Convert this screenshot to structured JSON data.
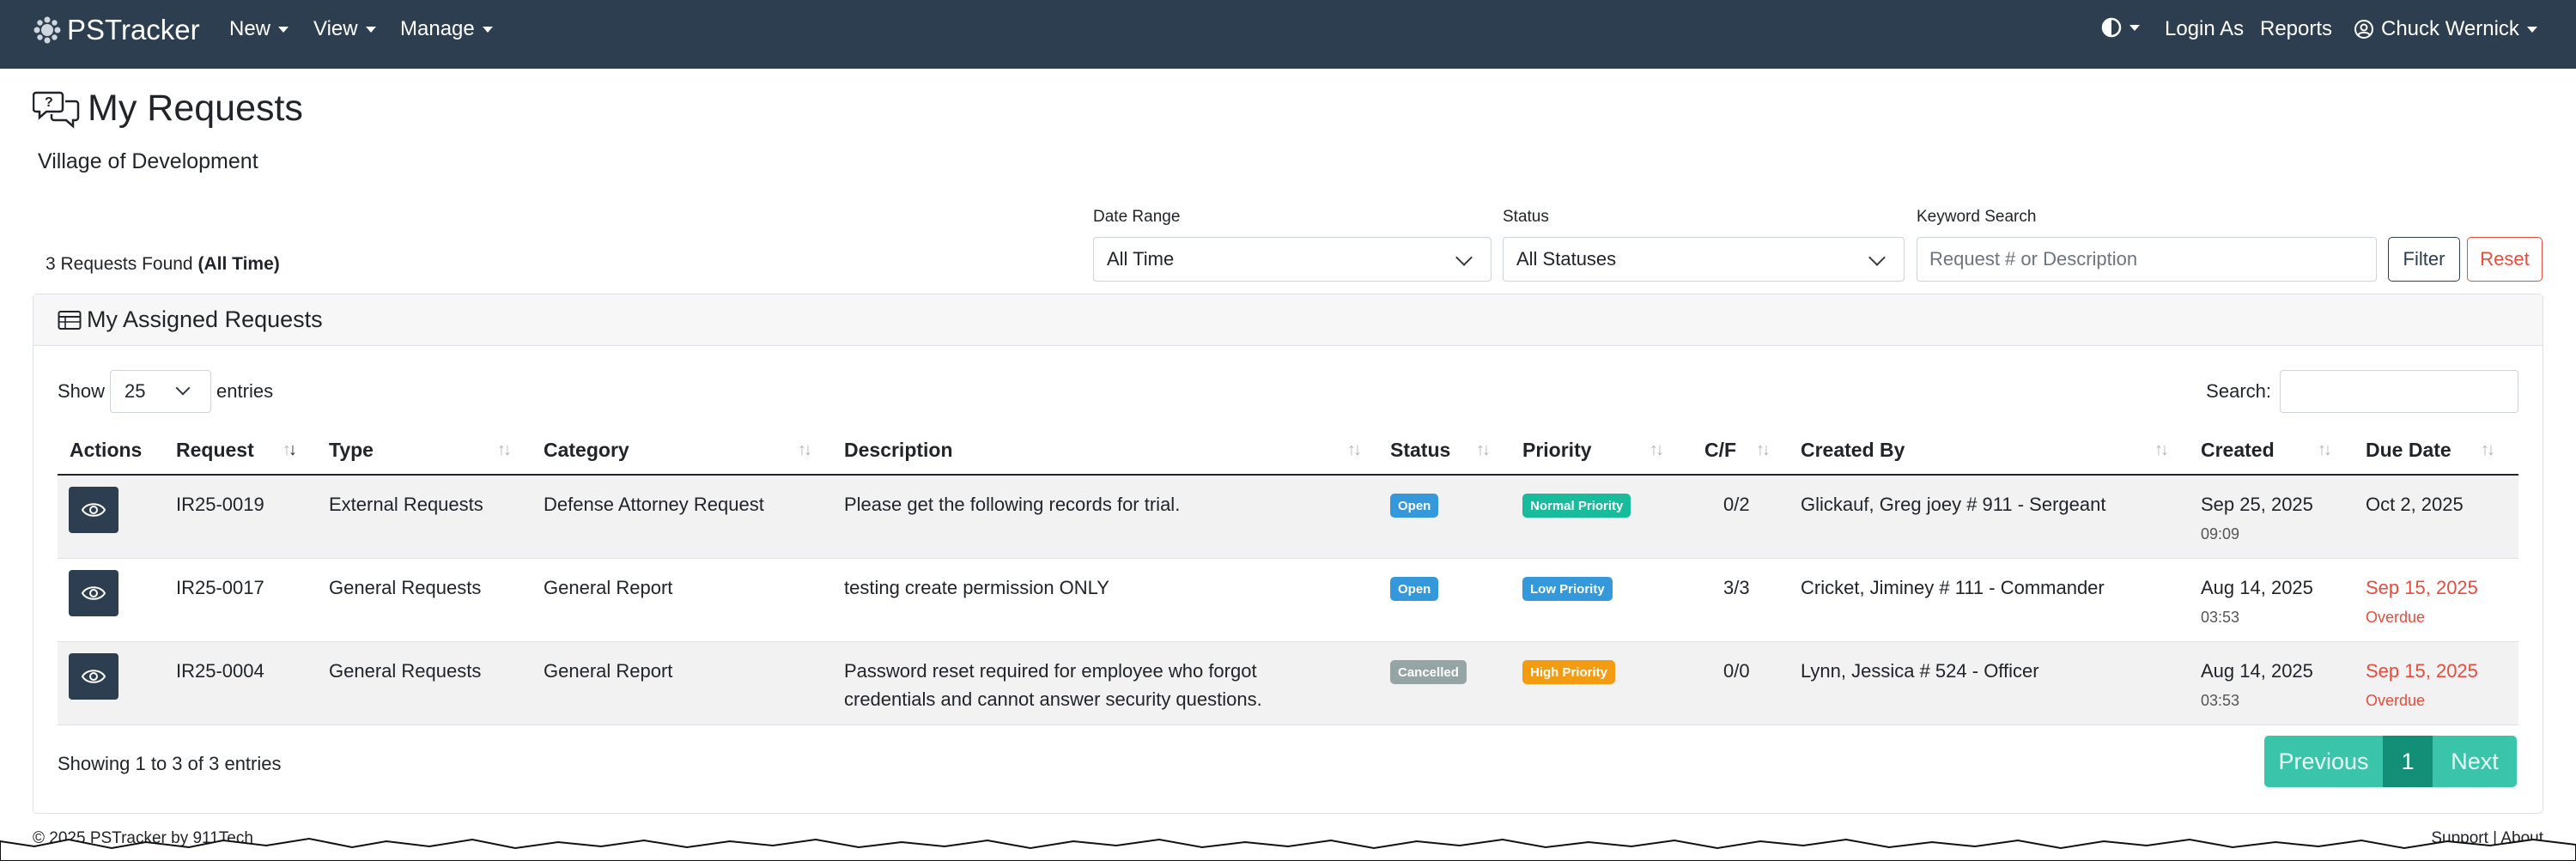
{
  "navbar": {
    "brand": "PSTracker",
    "menus": [
      "New",
      "View",
      "Manage"
    ],
    "right": {
      "login_as": "Login As",
      "reports": "Reports",
      "user": "Chuck Wernick"
    }
  },
  "page": {
    "title": "My Requests",
    "subtitle": "Village of Development",
    "found_count": "3 Requests Found",
    "found_range": "(All Time)"
  },
  "filters": {
    "date_range_label": "Date Range",
    "date_range_value": "All Time",
    "status_label": "Status",
    "status_value": "All Statuses",
    "keyword_label": "Keyword Search",
    "keyword_placeholder": "Request # or Description",
    "filter_button": "Filter",
    "reset_button": "Reset"
  },
  "card": {
    "title": "My Assigned Requests",
    "show_label": "Show",
    "entries_value": "25",
    "entries_label": "entries",
    "search_label": "Search:"
  },
  "table": {
    "headers": [
      "Actions",
      "Request",
      "Type",
      "Category",
      "Description",
      "Status",
      "Priority",
      "C/F",
      "Created By",
      "Created",
      "Due Date"
    ],
    "rows": [
      {
        "request": "IR25-0019",
        "type": "External Requests",
        "category": "Defense Attorney Request",
        "description_1": "Please get the following records for trial.",
        "description_2": "",
        "status": "Open",
        "priority": "Normal Priority",
        "cf": "0/2",
        "created_by": "Glickauf, Greg joey # 911 - Sergeant",
        "created_date": "Sep 25, 2025",
        "created_time": "09:09",
        "due_date": "Oct 2, 2025",
        "due_note": ""
      },
      {
        "request": "IR25-0017",
        "type": "General Requests",
        "category": "General Report",
        "description_1": "testing create permission ONLY",
        "description_2": "",
        "status": "Open",
        "priority": "Low Priority",
        "cf": "3/3",
        "created_by": "Cricket, Jiminey # 111 - Commander",
        "created_date": "Aug 14, 2025",
        "created_time": "03:53",
        "due_date": "Sep 15, 2025",
        "due_note": "Overdue"
      },
      {
        "request": "IR25-0004",
        "type": "General Requests",
        "category": "General Report",
        "description_1": "Password reset required for employee who forgot",
        "description_2": "credentials and cannot answer security questions.",
        "status": "Cancelled",
        "priority": "High Priority",
        "cf": "0/0",
        "created_by": "Lynn, Jessica # 524 - Officer",
        "created_date": "Aug 14, 2025",
        "created_time": "03:53",
        "due_date": "Sep 15, 2025",
        "due_note": "Overdue"
      }
    ],
    "showing": "Showing 1 to 3 of 3 entries"
  },
  "pagination": {
    "previous": "Previous",
    "current": "1",
    "next": "Next"
  },
  "footer": {
    "copyright": "© 2025 PSTracker by 911Tech",
    "support": "Support",
    "separator": "|",
    "about": "About"
  },
  "colors": {
    "navbar": "#2c3e50",
    "open": "#3498db",
    "normal": "#18bc9c",
    "low": "#3498db",
    "high": "#f39c12",
    "cancelled": "#95a5a6",
    "overdue": "#e74c3c",
    "reset": "#e74c3c"
  }
}
